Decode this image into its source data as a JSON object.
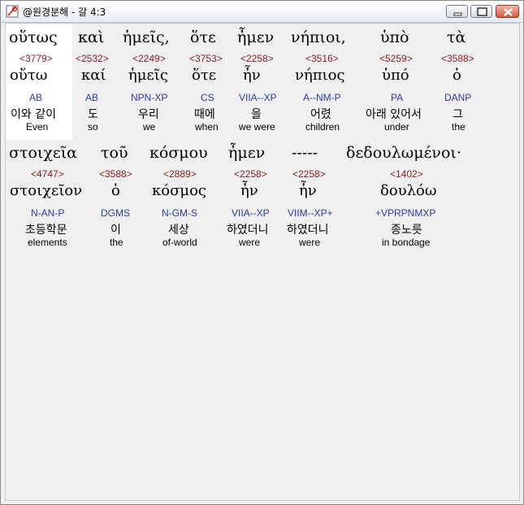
{
  "window": {
    "title": "@원경분해 - 갈 4:3"
  },
  "rows": [
    {
      "words": [
        {
          "greek": "οὕτως",
          "strong": "<3779>",
          "lemma": "οὕτω",
          "morph": "AB",
          "korean": "이와 같이",
          "english": "Even"
        },
        {
          "greek": "καὶ",
          "strong": "<2532>",
          "lemma": "καί",
          "morph": "AB",
          "korean": "도",
          "english": "so"
        },
        {
          "greek": "ἡμεῖς,",
          "strong": "<2249>",
          "lemma": "ἡμεῖς",
          "morph": "NPN-XP",
          "korean": "우리",
          "english": "we"
        },
        {
          "greek": "ὅτε",
          "strong": "<3753>",
          "lemma": "ὅτε",
          "morph": "CS",
          "korean": "때에",
          "english": "when"
        },
        {
          "greek": "ἦμεν",
          "strong": "<2258>",
          "lemma": "ἦν",
          "morph": "VIIA--XP",
          "korean": "을",
          "english": "we were"
        },
        {
          "greek": "νήπιοι,",
          "strong": "<3516>",
          "lemma": "νήπιος",
          "morph": "A--NM-P",
          "korean": "어렸",
          "english": "children"
        },
        {
          "greek": "ὑπὸ",
          "strong": "<5259>",
          "lemma": "ὑπό",
          "morph": "PA",
          "korean": "아래 있어서",
          "english": "under"
        },
        {
          "greek": "τὰ",
          "strong": "<3588>",
          "lemma": "ὁ",
          "morph": "DANP",
          "korean": "그",
          "english": "the"
        }
      ]
    },
    {
      "words": [
        {
          "greek": "στοιχεῖα",
          "strong": "<4747>",
          "lemma": "στοιχεῖον",
          "morph": "N-AN-P",
          "korean": "초등학문",
          "english": "elements"
        },
        {
          "greek": "τοῦ",
          "strong": "<3588>",
          "lemma": "ὁ",
          "morph": "DGMS",
          "korean": "이",
          "english": "the"
        },
        {
          "greek": "κόσμου",
          "strong": "<2889>",
          "lemma": "κόσμος",
          "morph": "N-GM-S",
          "korean": "세상",
          "english": "of-world"
        },
        {
          "greek": "ἦμεν",
          "strong": "<2258>",
          "lemma": "ἦν",
          "morph": "VIIA--XP",
          "korean": "하였더니",
          "english": "were"
        },
        {
          "greek": "-----",
          "strong": "<2258>",
          "lemma": "ἦν",
          "morph": "VIIM--XP+",
          "korean": "하였더니",
          "english": "were"
        },
        {
          "greek": "δεδουλωμένοι·",
          "strong": "<1402>",
          "lemma": "δουλόω",
          "morph": "+VPRPNMXP",
          "korean": "종노릇",
          "english": "in bondage"
        }
      ]
    }
  ]
}
